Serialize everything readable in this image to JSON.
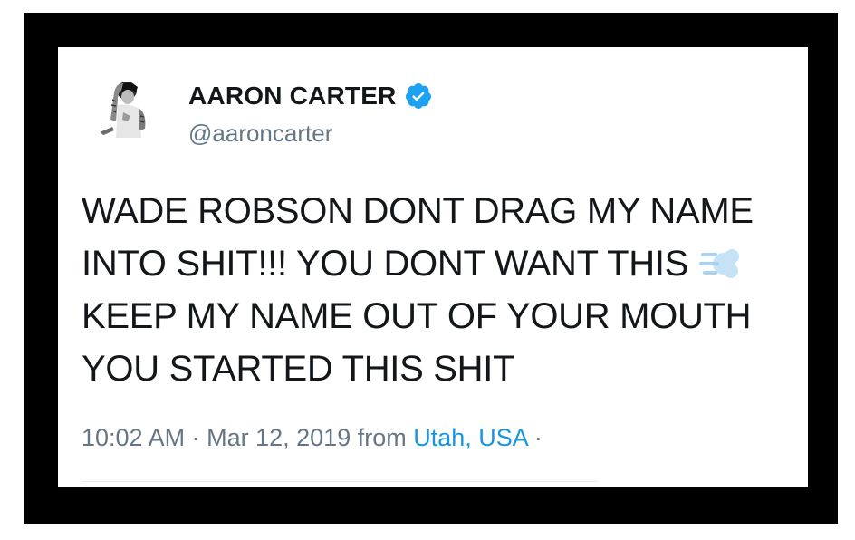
{
  "tweet": {
    "author": {
      "display_name": "AARON CARTER",
      "handle": "@aaroncarter",
      "verified": true,
      "avatar_icon": "profile-photo-grayscale"
    },
    "text_lines": [
      "WADE ROBSON DONT DRAG MY NAME",
      "INTO SHIT!!! YOU DONT WANT THIS",
      "KEEP MY NAME OUT OF YOUR MOUTH",
      "YOU STARTED THIS SHIT"
    ],
    "emoji": "dashing-away-emoji",
    "meta": {
      "time": "10:02 AM",
      "separator": "·",
      "date": "Mar 12, 2019",
      "from_label": "from",
      "location": "Utah, USA",
      "trailing_separator": "·"
    }
  },
  "colors": {
    "frame": "#000000",
    "card_bg": "#ffffff",
    "text": "#14171a",
    "secondary_text": "#657786",
    "link": "#1b95e0",
    "verified_badge": "#1da1f2",
    "emoji_blue": "#bcdff5"
  }
}
